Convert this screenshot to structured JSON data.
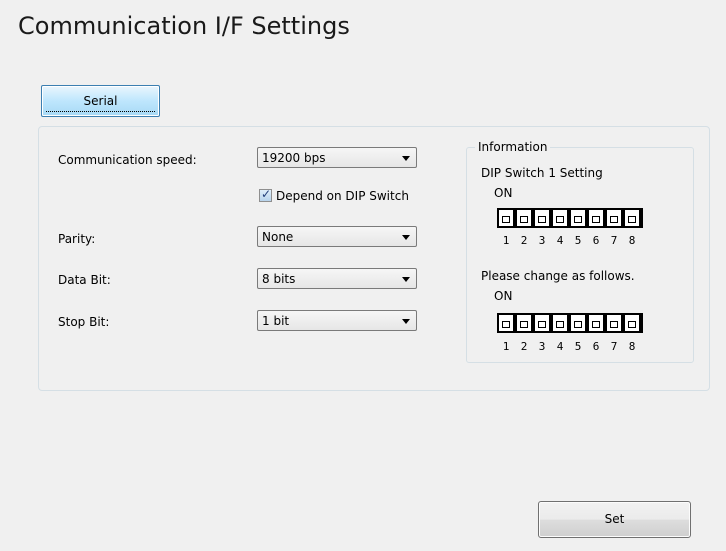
{
  "page": {
    "title": "Communication I/F Settings"
  },
  "tabs": [
    {
      "label": "Serial",
      "selected": true
    }
  ],
  "form": {
    "speed": {
      "label": "Communication speed:",
      "value": "19200 bps"
    },
    "depend": {
      "label": "Depend on DIP Switch",
      "checked": true
    },
    "parity": {
      "label": "Parity:",
      "value": "None"
    },
    "data_bit": {
      "label": "Data Bit:",
      "value": "8 bits"
    },
    "stop_bit": {
      "label": "Stop Bit:",
      "value": "1 bit"
    }
  },
  "information": {
    "legend": "Information",
    "dip_title": "DIP Switch 1 Setting",
    "on_label": "ON",
    "change_text": "Please change as follows.",
    "on_label_2": "ON",
    "switch_numbers": [
      "1",
      "2",
      "3",
      "4",
      "5",
      "6",
      "7",
      "8"
    ],
    "current_state": [
      "off",
      "off",
      "off",
      "off",
      "off",
      "off",
      "off",
      "off"
    ],
    "target_state": [
      "off",
      "off",
      "off",
      "off",
      "off",
      "off",
      "off",
      "off"
    ]
  },
  "actions": {
    "set_label": "Set"
  }
}
